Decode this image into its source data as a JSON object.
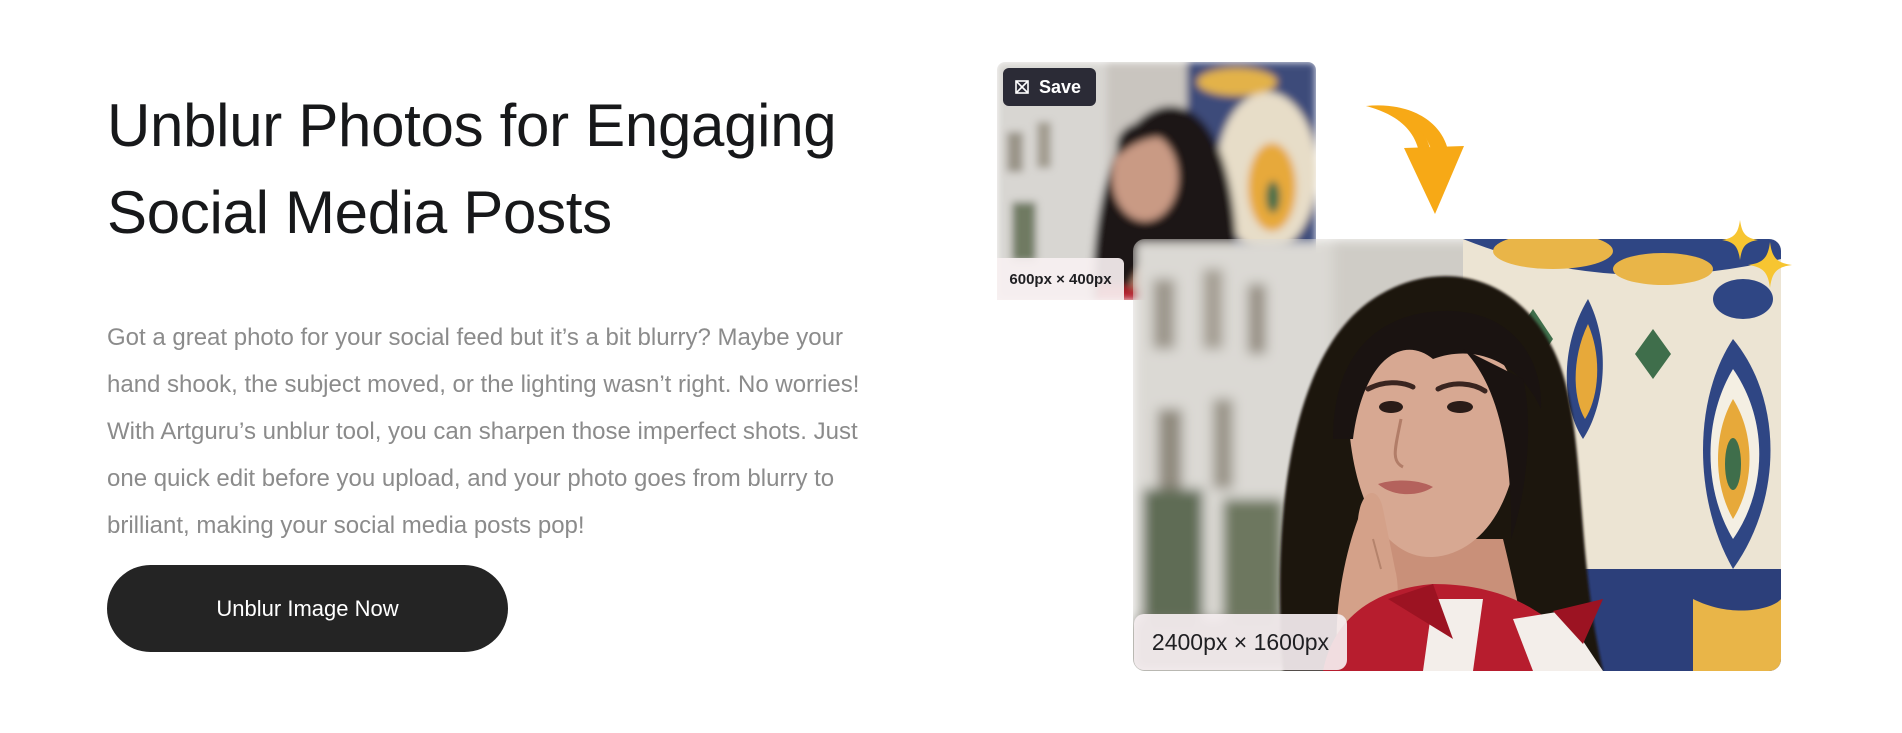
{
  "heading": {
    "line1": "Unblur Photos for Engaging",
    "line2": "Social Media Posts"
  },
  "description": "Got a great photo for your social feed but it’s a bit blurry? Maybe your hand shook, the subject moved, or the lighting wasn’t right. No worries! With Artguru’s unblur tool, you can sharpen those imperfect shots. Just one quick edit before you upload, and your photo goes from blurry to brilliant, making your social media posts pop!",
  "cta": {
    "label": "Unblur Image Now"
  },
  "before_image": {
    "save_label": "Save",
    "save_icon": "watermark-icon",
    "dimensions": "600px × 400px"
  },
  "after_image": {
    "dimensions": "2400px × 1600px"
  },
  "decorations": {
    "arrow_icon": "curved-arrow-down-icon",
    "sparkle_icon": "sparkles-icon",
    "accent_color": "#f7a916"
  }
}
